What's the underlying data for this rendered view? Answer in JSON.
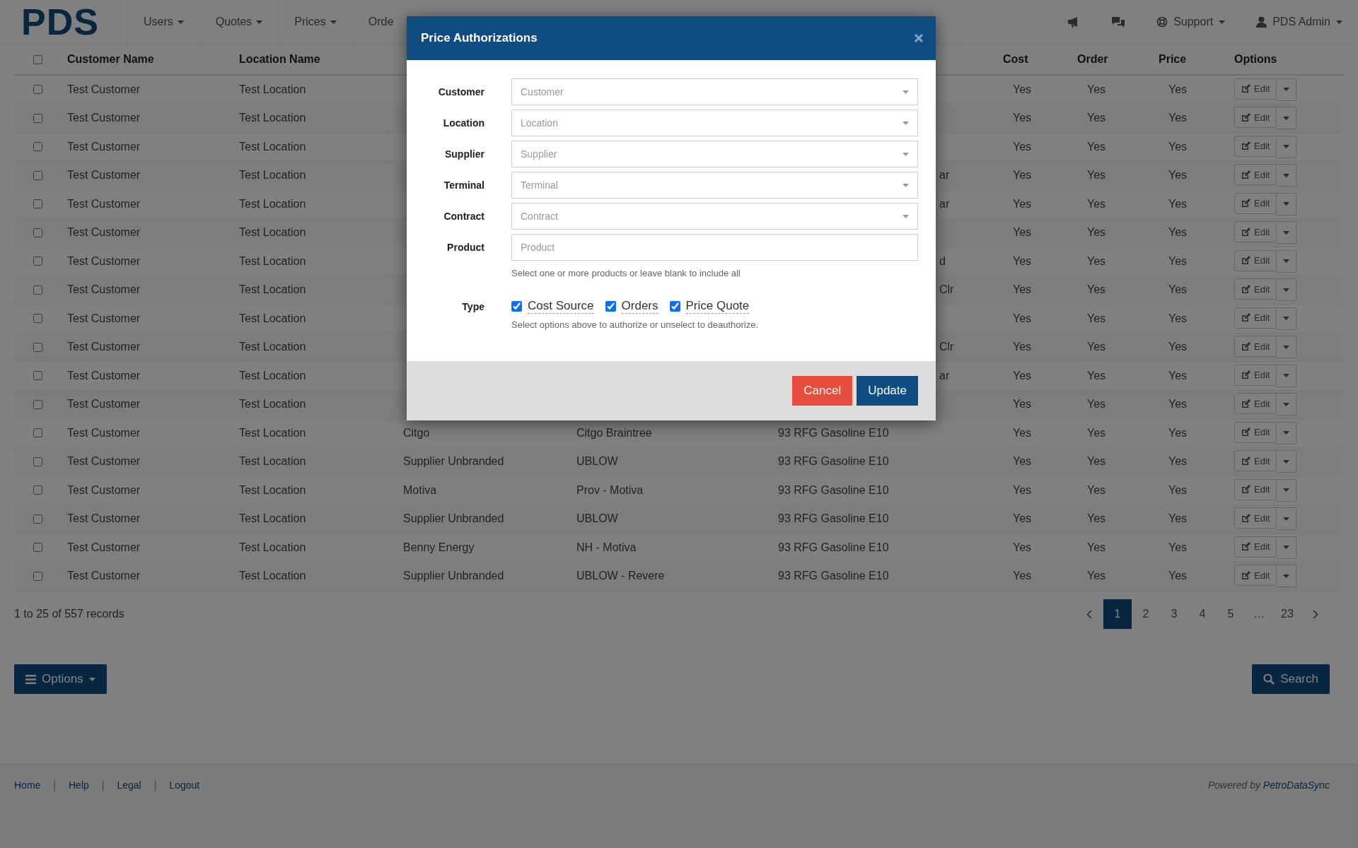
{
  "nav": {
    "logo": "PDS",
    "menus": [
      {
        "label": "Users",
        "dropdown": true
      },
      {
        "label": "Quotes",
        "dropdown": true
      },
      {
        "label": "Prices",
        "dropdown": true
      },
      {
        "label": "Orde",
        "dropdown": false
      }
    ],
    "user_menus": [
      {
        "label": "Support"
      },
      {
        "label": "PDS Admin"
      }
    ]
  },
  "table": {
    "select_all_checked": false,
    "columns": [
      "Customer Name",
      "Location Name",
      "Cost",
      "Order",
      "Price",
      "Options"
    ],
    "rows": [
      {
        "kind": "covered",
        "checked": false,
        "customer": "Test Customer",
        "location": "Test Location",
        "cost": "Yes",
        "order": "Yes",
        "price": "Yes",
        "action": "Edit"
      },
      {
        "kind": "covered",
        "checked": false,
        "customer": "Test Customer",
        "location": "Test Location",
        "cost": "Yes",
        "order": "Yes",
        "price": "Yes",
        "action": "Edit"
      },
      {
        "kind": "covered",
        "checked": false,
        "customer": "Test Customer",
        "location": "Test Location",
        "cost": "Yes",
        "order": "Yes",
        "price": "Yes",
        "action": "Edit"
      },
      {
        "kind": "covered",
        "checked": false,
        "customer": "Test Customer",
        "location": "Test Location",
        "column_5": "ar",
        "cost": "Yes",
        "order": "Yes",
        "price": "Yes",
        "action": "Edit"
      },
      {
        "kind": "covered",
        "checked": false,
        "customer": "Test Customer",
        "location": "Test Location",
        "column_5": "ar",
        "cost": "Yes",
        "order": "Yes",
        "price": "Yes",
        "action": "Edit"
      },
      {
        "kind": "covered",
        "checked": false,
        "customer": "Test Customer",
        "location": "Test Location",
        "cost": "Yes",
        "order": "Yes",
        "price": "Yes",
        "action": "Edit"
      },
      {
        "kind": "covered",
        "checked": false,
        "customer": "Test Customer",
        "location": "Test Location",
        "column_5": "d",
        "cost": "Yes",
        "order": "Yes",
        "price": "Yes",
        "action": "Edit"
      },
      {
        "kind": "covered",
        "checked": false,
        "customer": "Test Customer",
        "location": "Test Location",
        "column_5": "Clr",
        "cost": "Yes",
        "order": "Yes",
        "price": "Yes",
        "action": "Edit"
      },
      {
        "kind": "covered",
        "checked": false,
        "customer": "Test Customer",
        "location": "Test Location",
        "cost": "Yes",
        "order": "Yes",
        "price": "Yes",
        "action": "Edit"
      },
      {
        "kind": "covered",
        "checked": false,
        "customer": "Test Customer",
        "location": "Test Location",
        "column_5": "Clr",
        "cost": "Yes",
        "order": "Yes",
        "price": "Yes",
        "action": "Edit"
      },
      {
        "kind": "covered",
        "checked": false,
        "customer": "Test Customer",
        "location": "Test Location",
        "column_5": "ar",
        "cost": "Yes",
        "order": "Yes",
        "price": "Yes",
        "action": "Edit"
      },
      {
        "kind": "covered",
        "checked": false,
        "customer": "Test Customer",
        "location": "Test Location",
        "cost": "Yes",
        "order": "Yes",
        "price": "Yes",
        "action": "Edit"
      },
      {
        "kind": "full",
        "checked": false,
        "customer": "Test Customer",
        "location": "Test Location",
        "column_3": "Citgo",
        "column_4": "Citgo Braintree",
        "column_5": "93 RFG Gasoline E10",
        "cost": "Yes",
        "order": "Yes",
        "price": "Yes",
        "action": "Edit"
      },
      {
        "kind": "full",
        "checked": false,
        "customer": "Test Customer",
        "location": "Test Location",
        "column_3": "Supplier Unbranded",
        "column_4": "UBLOW",
        "column_5": "93 RFG Gasoline E10",
        "cost": "Yes",
        "order": "Yes",
        "price": "Yes",
        "action": "Edit"
      },
      {
        "kind": "full",
        "checked": false,
        "customer": "Test Customer",
        "location": "Test Location",
        "column_3": "Motiva",
        "column_4": "Prov - Motiva",
        "column_5": "93 RFG Gasoline E10",
        "cost": "Yes",
        "order": "Yes",
        "price": "Yes",
        "action": "Edit"
      },
      {
        "kind": "full",
        "checked": false,
        "customer": "Test Customer",
        "location": "Test Location",
        "column_3": "Supplier Unbranded",
        "column_4": "UBLOW",
        "column_5": "93 RFG Gasoline E10",
        "cost": "Yes",
        "order": "Yes",
        "price": "Yes",
        "action": "Edit"
      },
      {
        "kind": "full",
        "checked": false,
        "customer": "Test Customer",
        "location": "Test Location",
        "column_3": "Benny Energy",
        "column_4": "NH - Motiva",
        "column_5": "93 RFG Gasoline E10",
        "cost": "Yes",
        "order": "Yes",
        "price": "Yes",
        "action": "Edit"
      },
      {
        "kind": "full",
        "checked": false,
        "customer": "Test Customer",
        "location": "Test Location",
        "column_3": "Supplier Unbranded",
        "column_4": "UBLOW - Revere",
        "column_5": "93 RFG Gasoline E10",
        "cost": "Yes",
        "order": "Yes",
        "price": "Yes",
        "action": "Edit"
      }
    ]
  },
  "records": "1 to 25 of 557 records",
  "pagination": [
    {
      "label": "1",
      "selected": true
    },
    {
      "label": "2",
      "selected": false
    },
    {
      "label": "3",
      "selected": false
    },
    {
      "label": "4",
      "selected": false
    },
    {
      "label": "5",
      "selected": false
    },
    {
      "label": "…",
      "selected": false
    },
    {
      "label": "23",
      "selected": false
    }
  ],
  "options_button": "Options",
  "search_button": "Search",
  "footer": {
    "links": [
      "Home",
      "Help",
      "Legal",
      "Logout"
    ],
    "separator": "|",
    "powered_by": "Powered by",
    "brand": "PetroDataSync"
  },
  "modal": {
    "title": "Price Authorizations",
    "fields": [
      {
        "kind": "select",
        "label": "Customer",
        "placeholder": "Customer"
      },
      {
        "kind": "select",
        "label": "Location",
        "placeholder": "Location"
      },
      {
        "kind": "select",
        "label": "Supplier",
        "placeholder": "Supplier"
      },
      {
        "kind": "select",
        "label": "Terminal",
        "placeholder": "Terminal"
      },
      {
        "kind": "select",
        "label": "Contract",
        "placeholder": "Contract"
      },
      {
        "kind": "input",
        "label": "Product",
        "placeholder": "Product",
        "help": "Select one or more products or leave blank to include all"
      }
    ],
    "type": {
      "label": "Type",
      "options": [
        {
          "label": "Cost Source",
          "checked": true
        },
        {
          "label": "Orders",
          "checked": true
        },
        {
          "label": "Price Quote",
          "checked": true
        }
      ],
      "help": "Select options above to authorize or unselect to deauthorize."
    },
    "buttons": [
      {
        "kind": "cancel",
        "label": "Cancel"
      },
      {
        "kind": "primary",
        "label": "Update"
      }
    ]
  }
}
